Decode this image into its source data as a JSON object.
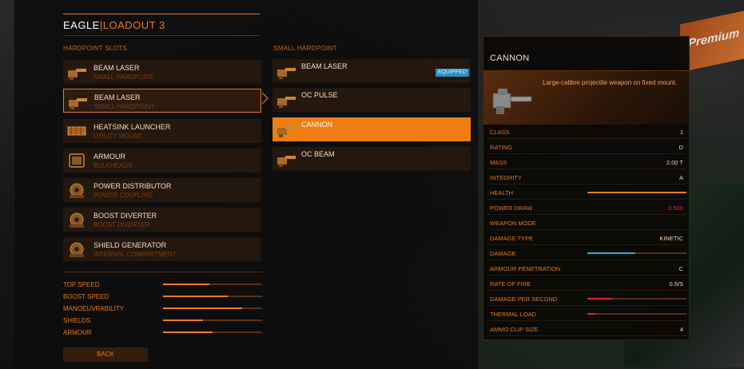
{
  "header": {
    "ship": "EAGLE",
    "separator": "|",
    "loadout": "LOADOUT 3"
  },
  "columns": {
    "slots_title": "HARDPOINT SLOTS",
    "options_title": "SMALL HARDPOINT"
  },
  "slots": [
    {
      "name": "BEAM LASER",
      "sub": "SMALL HARDPOINT",
      "icon": "beam-laser-icon"
    },
    {
      "name": "BEAM LASER",
      "sub": "SMALL HARDPOINT",
      "icon": "beam-laser-icon",
      "selected": true
    },
    {
      "name": "HEATSINK LAUNCHER",
      "sub": "UTILITY MOUNT",
      "icon": "heatsink-icon"
    },
    {
      "name": "ARMOUR",
      "sub": "BULKHEADS",
      "icon": "armour-icon"
    },
    {
      "name": "POWER DISTRIBUTOR",
      "sub": "POWER COUPLING",
      "icon": "power-distributor-icon"
    },
    {
      "name": "BOOST DIVERTER",
      "sub": "BOOST DIVERTER",
      "icon": "boost-diverter-icon"
    },
    {
      "name": "SHIELD GENERATOR",
      "sub": "INTERNAL COMPARTMENT",
      "icon": "shield-generator-icon"
    }
  ],
  "options": [
    {
      "name": "BEAM LASER",
      "badge": "EQUIPPED"
    },
    {
      "name": "OC PULSE"
    },
    {
      "name": "CANNON",
      "active": true
    },
    {
      "name": "OC BEAM"
    }
  ],
  "ship_stats": [
    {
      "label": "TOP SPEED",
      "value": 0.47
    },
    {
      "label": "BOOST SPEED",
      "value": 0.65
    },
    {
      "label": "MANOEUVRABILITY",
      "value": 0.8
    },
    {
      "label": "SHIELDS",
      "value": 0.4
    },
    {
      "label": "ARMOUR",
      "value": 0.5
    }
  ],
  "back_label": "BACK",
  "detail": {
    "title": "CANNON",
    "description": "Large-calibre projectile weapon on fixed mount.",
    "rows": [
      {
        "label": "CLASS",
        "value": "1"
      },
      {
        "label": "RATING",
        "value": "D"
      },
      {
        "label": "MASS",
        "value": "2.00 T"
      },
      {
        "label": "INTEGRITY",
        "value": "A"
      },
      {
        "label": "HEALTH",
        "bar": 1.0,
        "color": "#ef7e12"
      },
      {
        "label": "POWER DRAW",
        "value": "0.500",
        "red": true
      },
      {
        "label": "WEAPON MODE",
        "value": ""
      },
      {
        "label": "DAMAGE TYPE",
        "value": "KINETIC"
      },
      {
        "label": "DAMAGE",
        "bar": 0.48,
        "color": "#3aa8d8"
      },
      {
        "label": "ARMOUR PENETRATION",
        "value": "C"
      },
      {
        "label": "RATE OF FIRE",
        "value": "0.5/S"
      },
      {
        "label": "DAMAGE PER SECOND",
        "bar": 0.25,
        "color": "#e02a2a"
      },
      {
        "label": "THERMAL LOAD",
        "bar": 0.08,
        "color": "#e02a2a"
      },
      {
        "label": "AMMO CLIP SIZE",
        "value": "4"
      }
    ]
  },
  "background_sign": "Premium",
  "colors": {
    "accent": "#ef7e12",
    "equipped": "#2a8fc4",
    "negative": "#e02a2a"
  }
}
